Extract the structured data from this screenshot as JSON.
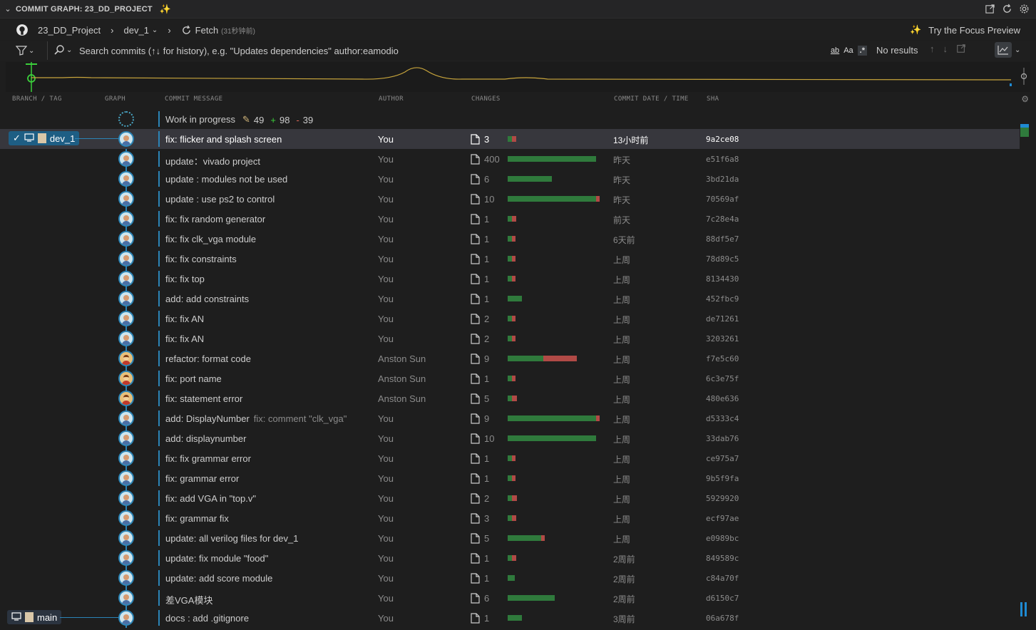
{
  "panel": {
    "title": "COMMIT GRAPH: 23_DD_PROJECT"
  },
  "toolbar": {
    "repo_name": "23_DD_Project",
    "branch": "dev_1",
    "fetch_label": "Fetch",
    "fetch_time": "(31秒钟前)",
    "focus_preview": "Try the Focus Preview"
  },
  "search": {
    "placeholder": "Search commits (↑↓ for history), e.g. \"Updates dependencies\" author:eamodio",
    "opt_whole_word": "ab",
    "opt_case": "Aa",
    "opt_regex": ".*",
    "results": "No results"
  },
  "columns": {
    "branch_tag": "BRANCH / TAG",
    "graph": "GRAPH",
    "message": "COMMIT MESSAGE",
    "author": "AUTHOR",
    "changes": "CHANGES",
    "date": "COMMIT DATE / TIME",
    "sha": "SHA"
  },
  "branches": {
    "current": "dev_1",
    "main": "main"
  },
  "wip": {
    "message": "Work in progress",
    "changed": "49",
    "added": "98",
    "removed": "39"
  },
  "colors": {
    "accent": "#2b84b6",
    "additions": "#2f7a3c",
    "deletions": "#b14a46",
    "minimap_line": "#c8a53c"
  },
  "commits": [
    {
      "message": "fix: flicker and splash screen",
      "author": "You",
      "count": "3",
      "add": 0.05,
      "del": 0.05,
      "date": "13小时前",
      "sha": "9a2ce08",
      "avatar": "me",
      "selected": true
    },
    {
      "message": "update：vivado project",
      "author": "You",
      "count": "400",
      "add": 1.0,
      "del": 0.0,
      "date": "昨天",
      "sha": "e51f6a8",
      "avatar": "me"
    },
    {
      "message": "update : modules not be used",
      "author": "You",
      "count": "6",
      "add": 0.5,
      "del": 0.0,
      "date": "昨天",
      "sha": "3bd21da",
      "avatar": "me"
    },
    {
      "message": "update : use ps2 to control",
      "author": "You",
      "count": "10",
      "add": 1.0,
      "del": 0.04,
      "date": "昨天",
      "sha": "70569af",
      "avatar": "me"
    },
    {
      "message": "fix: fix random generator",
      "author": "You",
      "count": "1",
      "add": 0.05,
      "del": 0.05,
      "date": "前天",
      "sha": "7c28e4a",
      "avatar": "me"
    },
    {
      "message": "fix: fix clk_vga module",
      "author": "You",
      "count": "1",
      "add": 0.05,
      "del": 0.04,
      "date": "6天前",
      "sha": "88df5e7",
      "avatar": "me"
    },
    {
      "message": "fix: fix constraints",
      "author": "You",
      "count": "1",
      "add": 0.05,
      "del": 0.04,
      "date": "上周",
      "sha": "78d89c5",
      "avatar": "me"
    },
    {
      "message": "fix: fix top",
      "author": "You",
      "count": "1",
      "add": 0.05,
      "del": 0.04,
      "date": "上周",
      "sha": "8134430",
      "avatar": "me"
    },
    {
      "message": "add: add constraints",
      "author": "You",
      "count": "1",
      "add": 0.16,
      "del": 0.0,
      "date": "上周",
      "sha": "452fbc9",
      "avatar": "me"
    },
    {
      "message": "fix: fix AN",
      "author": "You",
      "count": "2",
      "add": 0.05,
      "del": 0.04,
      "date": "上周",
      "sha": "de71261",
      "avatar": "me"
    },
    {
      "message": "fix: fix AN",
      "author": "You",
      "count": "2",
      "add": 0.05,
      "del": 0.04,
      "date": "上周",
      "sha": "3203261",
      "avatar": "me"
    },
    {
      "message": "refactor: format code",
      "author": "Anston Sun",
      "count": "9",
      "add": 0.4,
      "del": 0.38,
      "date": "上周",
      "sha": "f7e5c60",
      "avatar": "anston"
    },
    {
      "message": "fix: port name",
      "author": "Anston Sun",
      "count": "1",
      "add": 0.05,
      "del": 0.04,
      "date": "上周",
      "sha": "6c3e75f",
      "avatar": "anston"
    },
    {
      "message": "fix: statement error",
      "author": "Anston Sun",
      "count": "5",
      "add": 0.05,
      "del": 0.06,
      "date": "上周",
      "sha": "480e636",
      "avatar": "anston"
    },
    {
      "message": "add: DisplayNumber",
      "tag": "fix: comment \"clk_vga\"",
      "author": "You",
      "count": "9",
      "add": 1.0,
      "del": 0.04,
      "date": "上周",
      "sha": "d5333c4",
      "avatar": "me"
    },
    {
      "message": "add: displaynumber",
      "author": "You",
      "count": "10",
      "add": 1.0,
      "del": 0.0,
      "date": "上周",
      "sha": "33dab76",
      "avatar": "me"
    },
    {
      "message": "fix: fix grammar error",
      "author": "You",
      "count": "1",
      "add": 0.05,
      "del": 0.04,
      "date": "上周",
      "sha": "ce975a7",
      "avatar": "me"
    },
    {
      "message": "fix: grammar error",
      "author": "You",
      "count": "1",
      "add": 0.05,
      "del": 0.04,
      "date": "上周",
      "sha": "9b5f9fa",
      "avatar": "me"
    },
    {
      "message": "fix: add VGA in \"top.v\"",
      "author": "You",
      "count": "2",
      "add": 0.05,
      "del": 0.06,
      "date": "上周",
      "sha": "5929920",
      "avatar": "me"
    },
    {
      "message": "fix: grammar fix",
      "author": "You",
      "count": "3",
      "add": 0.05,
      "del": 0.05,
      "date": "上周",
      "sha": "ecf97ae",
      "avatar": "me"
    },
    {
      "message": "update: all verilog files for dev_1",
      "author": "You",
      "count": "5",
      "add": 0.38,
      "del": 0.04,
      "date": "上周",
      "sha": "e0989bc",
      "avatar": "me"
    },
    {
      "message": "update: fix module \"food\"",
      "author": "You",
      "count": "1",
      "add": 0.05,
      "del": 0.05,
      "date": "2周前",
      "sha": "849589c",
      "avatar": "me"
    },
    {
      "message": "update: add score module",
      "author": "You",
      "count": "1",
      "add": 0.08,
      "del": 0.0,
      "date": "2周前",
      "sha": "c84a70f",
      "avatar": "me"
    },
    {
      "message": "差VGA模块",
      "author": "You",
      "count": "6",
      "add": 0.53,
      "del": 0.0,
      "date": "2周前",
      "sha": "d6150c7",
      "avatar": "me"
    },
    {
      "message": "docs : add .gitignore",
      "author": "You",
      "count": "1",
      "add": 0.16,
      "del": 0.0,
      "date": "3周前",
      "sha": "06a678f",
      "avatar": "me"
    }
  ]
}
